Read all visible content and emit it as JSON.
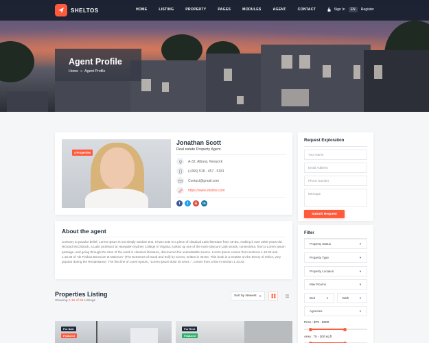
{
  "header": {
    "logo_text": "SHELTOS",
    "nav": [
      "HOME",
      "LISTING",
      "PROPERTY",
      "PAGES",
      "MODULES",
      "AGENT",
      "CONTACT"
    ],
    "sign_in": "Sign In",
    "lang": "EN",
    "register": "Register"
  },
  "hero": {
    "title": "Agent Profile",
    "crumb_home": "Home",
    "crumb_sep": "»",
    "crumb_current": "Agent Profile"
  },
  "agent": {
    "badge": "4 Properties",
    "name": "Jonathan Scott",
    "role": "Real estate Property Agent",
    "address": "A-32, Albany, Newyork",
    "phone": "(+066) 518 - 457 - 5181",
    "email": "Contact@gmail.com",
    "website": "https://www.sheltos.com"
  },
  "about": {
    "title": "About the agent",
    "text": "Contrary to popular belief, Lorem Ipsum is not simply random text. It has roots in a piece of classical Latin literature from 45 BC, making it over 2000 years old. Richard McClintock, a Latin professor at Hampden-Sydney College in Virginia, looked up one of the more obscure Latin words, consectetur, from a Lorem Ipsum passage, and going through the cites of the word in classical literature, discovered the undoubtable source. Lorem Ipsum comes from sections 1.10.32 and 1.10.33 of \"de Finibus Bonorum et Malorum\" (The Extremes of Good and Evil) by Cicero, written in 45 BC. This book is a treatise on the theory of ethics, very popular during the Renaissance. The first line of Lorem Ipsum, \"Lorem ipsum dolor sit amet..\", comes from a line in section 1.10.32."
  },
  "listing": {
    "title": "Properties Listing",
    "sub_prefix": "Showing ",
    "sub_count": "1-15 of 69",
    "sub_suffix": " Listings",
    "sort": "Sort by Newest",
    "cards": [
      {
        "badge1": "For Sale",
        "badge2": "Featured"
      },
      {
        "badge1": "For Rent",
        "badge2": "Featured"
      }
    ]
  },
  "request": {
    "title": "Request Exploration",
    "name_ph": "Your Name",
    "email_ph": "Email Address",
    "phone_ph": "Phone Number",
    "message_ph": "Message",
    "submit": "Submit Request"
  },
  "filter": {
    "title": "Filter",
    "status": "Property Status",
    "type": "Property Type",
    "location": "Property Location",
    "rooms": "Max Rooms",
    "bed": "Bed",
    "bath": "Bath",
    "agencies": "Agencies",
    "price": "Price : $75 - $300",
    "price_range": [
      0.1,
      0.65
    ],
    "area": "Area : 75 - 300 sq ft",
    "area_range": [
      0.1,
      0.65
    ]
  },
  "colors": {
    "accent": "#ff5a3c",
    "dark": "#1f2a3a"
  }
}
